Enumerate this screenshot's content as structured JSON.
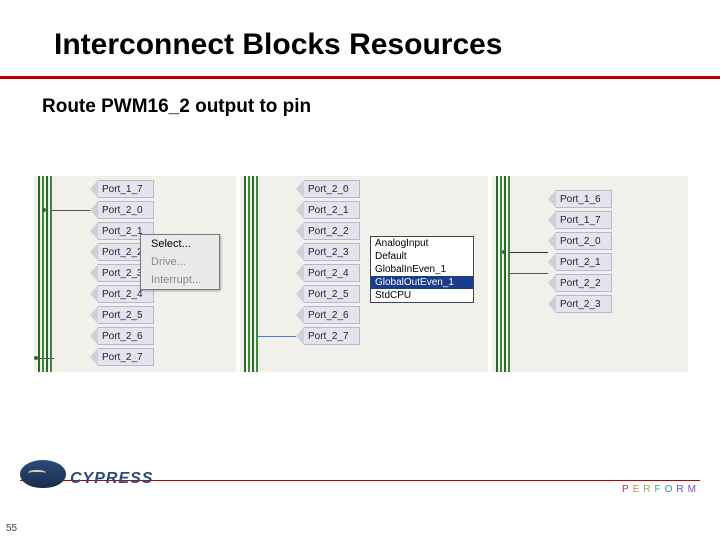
{
  "slide": {
    "title": "Interconnect Blocks Resources",
    "subtitle": "Route PWM16_2 output to pin",
    "page_number": "55"
  },
  "panel1": {
    "ports": [
      "Port_1_7",
      "Port_2_0",
      "Port_2_1",
      "Port_2_2",
      "Port_2_3",
      "Port_2_4",
      "Port_2_5",
      "Port_2_6",
      "Port_2_7"
    ],
    "context_menu": [
      "Select...",
      "Drive...",
      "Interrupt..."
    ]
  },
  "panel2": {
    "ports": [
      "Port_2_0",
      "Port_2_1",
      "Port_2_2",
      "Port_2_3",
      "Port_2_4",
      "Port_2_5",
      "Port_2_6",
      "Port_2_7"
    ],
    "dropdown": {
      "options": [
        "AnalogInput",
        "Default",
        "GlobalInEven_1",
        "GlobalOutEven_1",
        "StdCPU"
      ],
      "selected": "GlobalOutEven_1"
    }
  },
  "panel3": {
    "ports": [
      "Port_1_6",
      "Port_1_7",
      "Port_2_0",
      "Port_2_1",
      "Port_2_2",
      "Port_2_3"
    ]
  },
  "logo": {
    "text": "CYPRESS"
  },
  "perform": [
    "P",
    "E",
    "R",
    "F",
    "O",
    "R",
    "M"
  ]
}
